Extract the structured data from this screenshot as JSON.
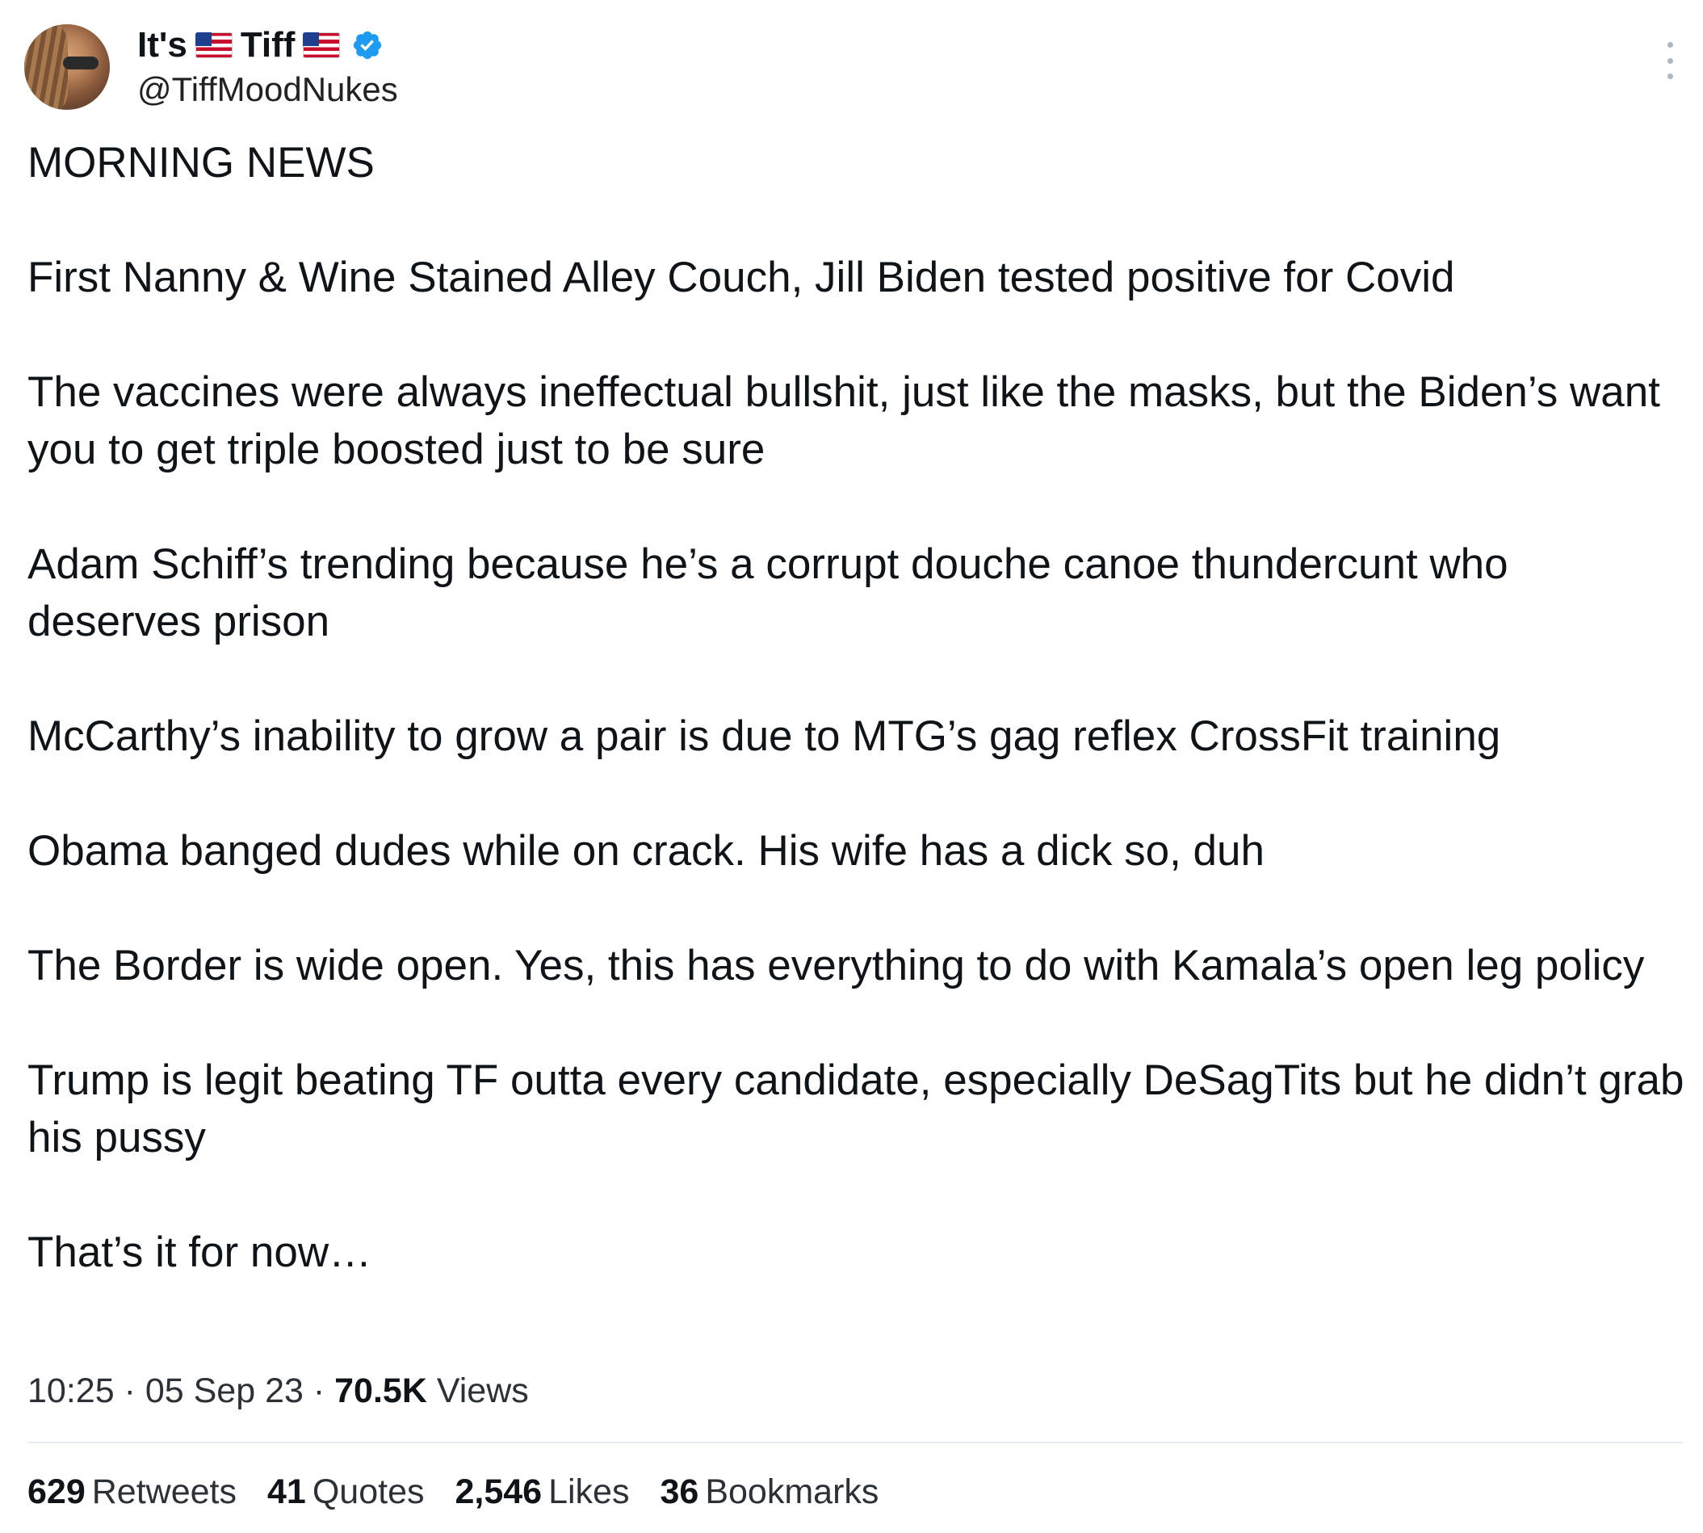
{
  "author": {
    "display_name_prefix": "It's",
    "display_name_main": "Tiff",
    "handle": "@TiffMoodNukes",
    "verified": true,
    "verified_color": "#1d9bf0",
    "icons": [
      "us-flag-icon",
      "us-flag-icon",
      "verified-badge-icon",
      "more-options-icon"
    ]
  },
  "tweet": {
    "paragraphs": [
      "MORNING NEWS",
      "First Nanny & Wine Stained Alley Couch, Jill Biden tested positive for Covid",
      "The vaccines were always ineffectual bullshit, just like the masks, but the Biden’s want you to get triple boosted just to be sure",
      "Adam Schiff’s trending because he’s a corrupt douche canoe thundercunt who deserves prison",
      "McCarthy’s inability to grow a pair is due to MTG’s gag reflex CrossFit training",
      "Obama banged dudes while on crack. His wife has a dick so, duh",
      "The Border is wide open. Yes, this has everything to do with Kamala’s open leg policy",
      "Trump is legit beating TF outta every candidate, especially DeSagTits but he didn’t grab his pussy",
      "That’s it for now…"
    ]
  },
  "meta": {
    "time": "10:25",
    "sep": "·",
    "date": "05 Sep 23",
    "views_count": "70.5K",
    "views_label": "Views"
  },
  "stats": [
    {
      "count": "629",
      "label": "Retweets"
    },
    {
      "count": "41",
      "label": "Quotes"
    },
    {
      "count": "2,546",
      "label": "Likes"
    },
    {
      "count": "36",
      "label": "Bookmarks"
    }
  ]
}
